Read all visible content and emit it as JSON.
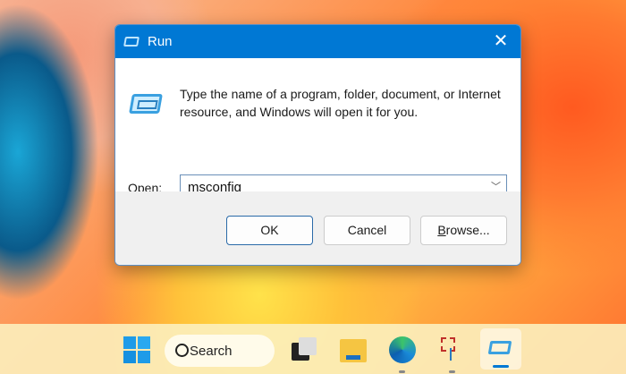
{
  "dialog": {
    "title": "Run",
    "message": "Type the name of a program, folder, document, or Internet resource, and Windows will open it for you.",
    "open_label_accel": "O",
    "open_label_rest": "pen:",
    "open_value": "msconfig",
    "ok": "OK",
    "cancel": "Cancel",
    "browse_accel": "B",
    "browse_rest": "rowse..."
  },
  "taskbar": {
    "search_label": "Search",
    "accent": "#0078d4"
  }
}
